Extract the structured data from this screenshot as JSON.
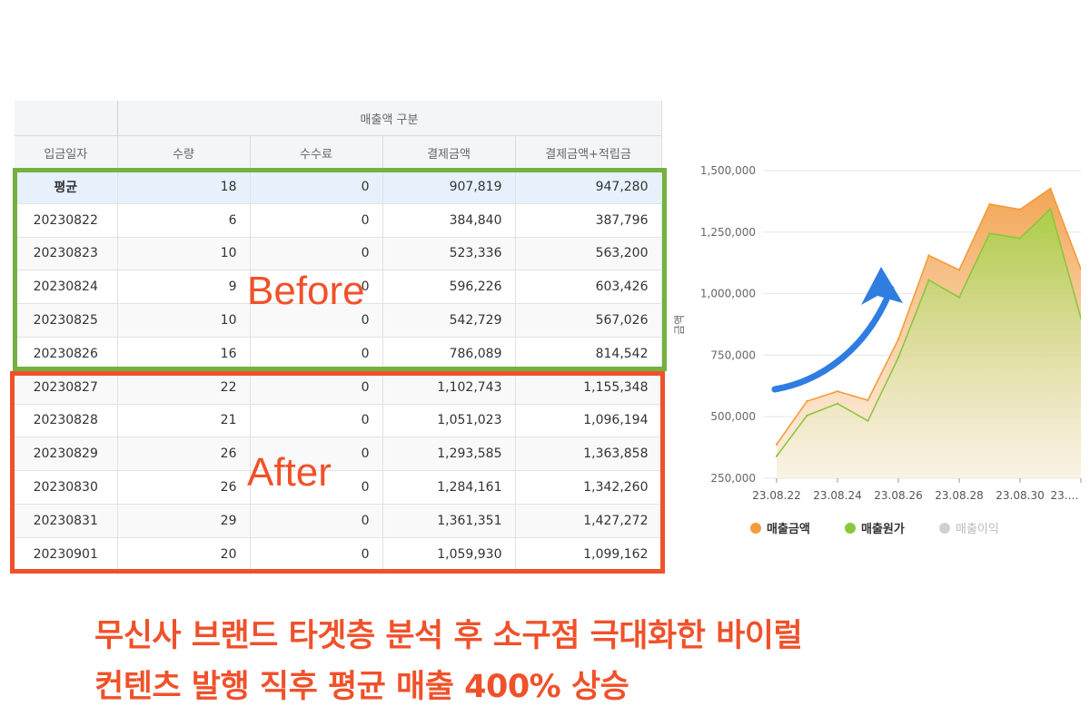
{
  "table": {
    "group_header": "매출액 구분",
    "columns": [
      "입금일자",
      "수량",
      "수수료",
      "결제금액",
      "결제금액+적립금"
    ],
    "rows": [
      [
        "평균",
        "18",
        "0",
        "907,819",
        "947,280"
      ],
      [
        "20230822",
        "6",
        "0",
        "384,840",
        "387,796"
      ],
      [
        "20230823",
        "10",
        "0",
        "523,336",
        "563,200"
      ],
      [
        "20230824",
        "9",
        "0",
        "596,226",
        "603,426"
      ],
      [
        "20230825",
        "10",
        "0",
        "542,729",
        "567,026"
      ],
      [
        "20230826",
        "16",
        "0",
        "786,089",
        "814,542"
      ],
      [
        "20230827",
        "22",
        "0",
        "1,102,743",
        "1,155,348"
      ],
      [
        "20230828",
        "21",
        "0",
        "1,051,023",
        "1,096,194"
      ],
      [
        "20230829",
        "26",
        "0",
        "1,293,585",
        "1,363,858"
      ],
      [
        "20230830",
        "26",
        "0",
        "1,284,161",
        "1,342,260"
      ],
      [
        "20230831",
        "29",
        "0",
        "1,361,351",
        "1,427,272"
      ],
      [
        "20230901",
        "20",
        "0",
        "1,059,930",
        "1,099,162"
      ]
    ]
  },
  "annotations": {
    "before": "Before",
    "after": "After"
  },
  "caption": {
    "line1": "무신사 브랜드 타겟층 분석 후 소구점 극대화한 바이럴",
    "line2": "컨텐츠 발행 직후 평균 매출 400% 상승"
  },
  "chart_data": {
    "type": "area",
    "ylabel": "금액",
    "ylim": [
      250000,
      1500000
    ],
    "yticks": [
      "1,500,000",
      "1,250,000",
      "1,000,000",
      "750,000",
      "500,000",
      "250,000"
    ],
    "ytick_values": [
      1500000,
      1250000,
      1000000,
      750000,
      500000,
      250000
    ],
    "xticks": [
      "23.08.22",
      "23.08.24",
      "23.08.26",
      "23.08.28",
      "23.08.30",
      "23.…"
    ],
    "x": [
      "23.08.22",
      "23.08.23",
      "23.08.24",
      "23.08.25",
      "23.08.26",
      "23.08.27",
      "23.08.28",
      "23.08.29",
      "23.08.30",
      "23.08.31",
      "23.09.01"
    ],
    "series": [
      {
        "name": "매출금액",
        "color": "#f39c3b",
        "values": [
          387796,
          563200,
          603426,
          567026,
          814542,
          1155348,
          1096194,
          1363858,
          1342260,
          1427272,
          1099162
        ]
      },
      {
        "name": "매출원가",
        "color": "#8cc63f",
        "values": [
          340000,
          505000,
          553000,
          483000,
          740000,
          1055000,
          985000,
          1245000,
          1225000,
          1345000,
          900000
        ]
      },
      {
        "name": "매출이익",
        "color": "#cccccc",
        "values": []
      }
    ],
    "grid": true,
    "legend_position": "bottom",
    "trend_arrow_color": "#2f7de1"
  }
}
